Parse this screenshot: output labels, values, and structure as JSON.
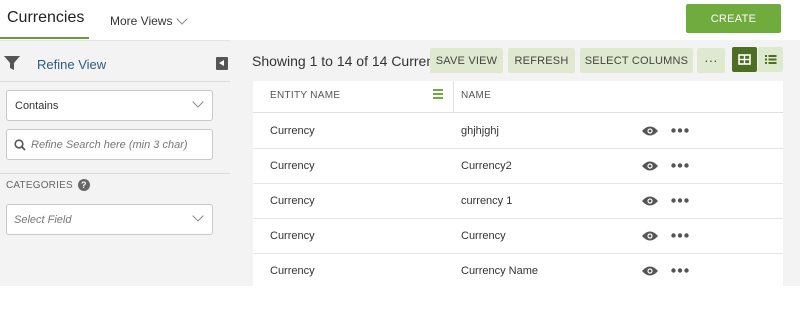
{
  "header": {
    "title": "Currencies",
    "more_views": "More Views",
    "create": "CREATE"
  },
  "sidebar": {
    "refine_label": "Refine View",
    "operator": "Contains",
    "search_placeholder": "Refine Search here (min 3 char)",
    "categories_label": "CATEGORIES",
    "select_field_placeholder": "Select Field"
  },
  "toolbar": {
    "showing": "Showing 1 to 14 of 14 Currencies",
    "save_view": "SAVE VIEW",
    "refresh": "REFRESH",
    "select_columns": "SELECT COLUMNS",
    "more": "···"
  },
  "table": {
    "columns": [
      "ENTITY NAME",
      "NAME"
    ],
    "rows": [
      {
        "entity": "Currency",
        "name": "ghjhjghj"
      },
      {
        "entity": "Currency",
        "name": "Currency2"
      },
      {
        "entity": "Currency",
        "name": "currency 1"
      },
      {
        "entity": "Currency",
        "name": "Currency"
      },
      {
        "entity": "Currency",
        "name": "Currency Name"
      }
    ]
  },
  "colors": {
    "accent": "#6fab3d",
    "toolbar_button": "#dfe9cf",
    "active_toggle": "#4c6f24",
    "link": "#2c5d7c"
  }
}
